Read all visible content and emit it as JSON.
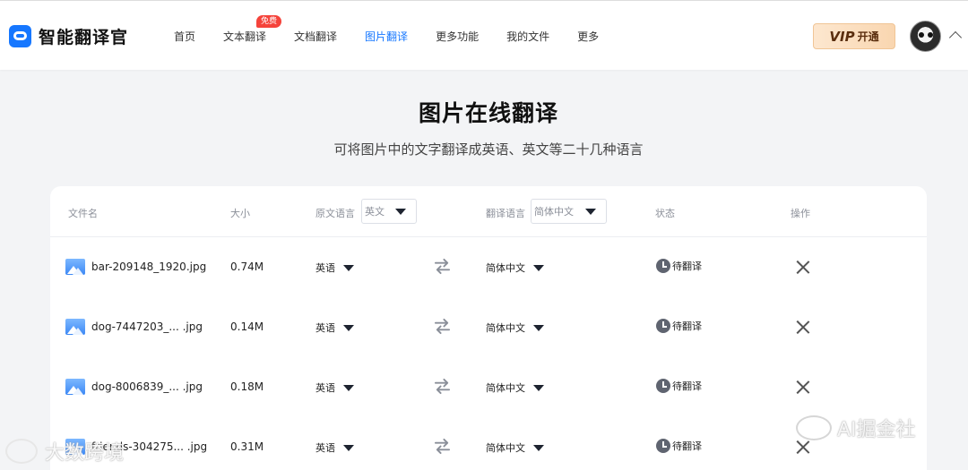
{
  "app": {
    "name": "智能翻译官",
    "brand_color": "#1677ff"
  },
  "nav": {
    "items": [
      {
        "label": "首页",
        "active": false
      },
      {
        "label": "文本翻译",
        "active": false,
        "badge": "免费"
      },
      {
        "label": "文档翻译",
        "active": false
      },
      {
        "label": "图片翻译",
        "active": true
      },
      {
        "label": "更多功能",
        "active": false
      },
      {
        "label": "我的文件",
        "active": false
      },
      {
        "label": "更多",
        "active": false
      }
    ]
  },
  "header": {
    "vip_word": "VIP",
    "vip_label": "开通",
    "avatar_icon": "panda-avatar",
    "menu_icon": "chevron-up-icon"
  },
  "page": {
    "title": "图片在线翻译",
    "subtitle": "可将图片中的文字翻译成英语、英文等二十几种语言"
  },
  "table": {
    "columns": {
      "file_name": "文件名",
      "size": "大小",
      "source_lang": "原文语言",
      "source_lang_value": "英文",
      "target_lang": "翻译语言",
      "target_lang_value": "简体中文",
      "status": "状态",
      "actions": "操作"
    },
    "rows": [
      {
        "file_name": "bar-209148_1920.jpg",
        "size": "0.74M",
        "source_lang": "英语",
        "target_lang": "简体中文",
        "status": "待翻译"
      },
      {
        "file_name": "dog-7447203_... .jpg",
        "size": "0.14M",
        "source_lang": "英语",
        "target_lang": "简体中文",
        "status": "待翻译"
      },
      {
        "file_name": "dog-8006839_... .jpg",
        "size": "0.18M",
        "source_lang": "英语",
        "target_lang": "简体中文",
        "status": "待翻译"
      },
      {
        "file_name": "friends-304275... .jpg",
        "size": "0.31M",
        "source_lang": "英语",
        "target_lang": "简体中文",
        "status": "待翻译"
      }
    ]
  },
  "watermarks": {
    "right": "AI掘金社",
    "left": "大数跨境"
  }
}
